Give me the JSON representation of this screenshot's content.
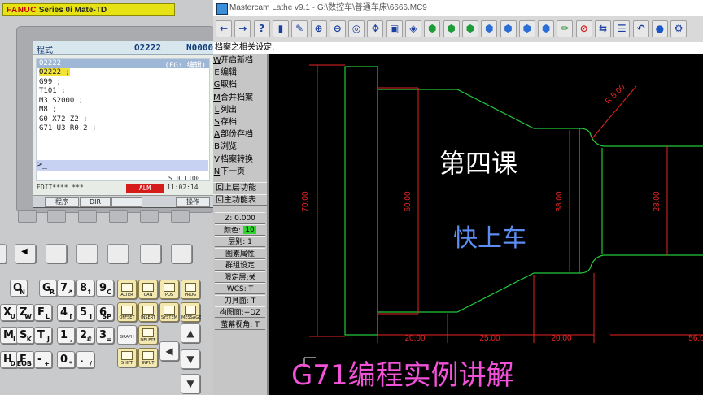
{
  "fanuc": {
    "title_brand": "FANUC",
    "title_rest": " Series 0i Mate-TD",
    "screen": {
      "header_left": "程式",
      "header_prog": "O2222",
      "header_right": "N0000",
      "prog_bar_left": "O2222",
      "prog_bar_right": "(FG: 编辑)",
      "lines": [
        "O2222 ;",
        "G99 ;",
        "T101 ;",
        "M3 S2000 ;",
        "M8 ;",
        "G0 X72 Z2 ;",
        "G71 U3 R0.2 ;"
      ],
      "input_prompt": ">_",
      "status_s": "S   0 L100",
      "mode": "EDIT**** ***",
      "alarm": "ALM",
      "time": "11:02:14",
      "soft_keys": [
        "程序",
        "DIR",
        "",
        "操作"
      ]
    },
    "keys": [
      {
        "big": "O",
        "sm": "N"
      },
      {
        "big": "G",
        "sm": "R"
      },
      {
        "big": "7",
        "sm": "↗"
      },
      {
        "big": "8",
        "sm": "↑"
      },
      {
        "big": "9",
        "sm": "C"
      },
      {
        "big": "X",
        "sm": "U"
      },
      {
        "big": "Z",
        "sm": "W"
      },
      {
        "big": "F",
        "sm": "L"
      },
      {
        "big": "4",
        "sm": "["
      },
      {
        "big": "5",
        "sm": "]"
      },
      {
        "big": "6",
        "sm": "SP"
      },
      {
        "big": "M",
        "sm": "I"
      },
      {
        "big": "S",
        "sm": "K"
      },
      {
        "big": "T",
        "sm": "J"
      },
      {
        "big": "1",
        "sm": ","
      },
      {
        "big": "2",
        "sm": "#"
      },
      {
        "big": "3",
        "sm": "="
      },
      {
        "big": "H",
        "sm": "D"
      },
      {
        "big": "E",
        "sm": "EOB"
      },
      {
        "big": "-",
        "sm": "+"
      },
      {
        "big": "0",
        "sm": "*"
      },
      {
        "big": ".",
        "sm": "/"
      }
    ],
    "function_keys": [
      "ALTER",
      "CAN",
      "POS",
      "PROG",
      "OFFSET",
      "INSERT",
      "SYSTEM",
      "MESSAGE",
      "GRAPH",
      "DELETE",
      "SHIFT",
      "INPUT"
    ]
  },
  "mastercam": {
    "title": "Mastercam Lathe v9.1 - G:\\数控车\\普通车床\\6666.MC9",
    "toolbar_icons": [
      "arrow-left-icon",
      "arrow-right-icon",
      "help-icon",
      "save-icon",
      "measure-icon",
      "zoom-in-icon",
      "zoom-out-icon",
      "zoom-fit-icon",
      "pan-icon",
      "zoom-window-icon",
      "view-iso-icon",
      "cube-top-icon",
      "cube-front-icon",
      "cube-side-icon",
      "cube-iso-icon",
      "cube-back-icon",
      "cube-right-icon",
      "cube-left-icon",
      "pen-icon",
      "clear-icon",
      "swap-icon",
      "layers-icon",
      "undo-icon",
      "shade-icon",
      "gear-icon"
    ],
    "prompt": "档案之相关设定:",
    "menu": [
      {
        "key": "W",
        "label": "开启新档"
      },
      {
        "key": "E",
        "label": "编辑"
      },
      {
        "key": "G",
        "label": "取档"
      },
      {
        "key": "M",
        "label": "合并档案"
      },
      {
        "key": "L",
        "label": "列出"
      },
      {
        "key": "S",
        "label": "存档"
      },
      {
        "key": "A",
        "label": "部份存档"
      },
      {
        "key": "B",
        "label": "浏览"
      },
      {
        "key": "V",
        "label": "档案转换"
      },
      {
        "key": "N",
        "label": "下一页"
      }
    ],
    "nav": [
      "回上层功能",
      "回主功能表"
    ],
    "status": {
      "z": "Z: 0.000",
      "color_label": "颜色:",
      "color_value": "10",
      "layer": "层别: 1",
      "attr": "图素属性",
      "group": "群组设定",
      "limit": "限定层:关",
      "wcs": "WCS: T",
      "tool_plane": "刀具面: T",
      "construct": "构图面:+DZ",
      "view": "萤幕视角: T"
    },
    "dims": {
      "radius": "R 5.00",
      "d70": "70.00",
      "d60": "60.00",
      "d38": "38.00",
      "d28": "28.00",
      "l20a": "20.00",
      "l25": "25.00",
      "l20b": "20.00",
      "l56": "56.0"
    }
  },
  "captions": {
    "title": "第四课",
    "subtitle": "快上车",
    "bottom": "G71编程实例讲解"
  },
  "colors": {
    "part_outline": "#22c83a",
    "dimension": "#e82424",
    "caption_title": "#ffffff",
    "caption_sub": "#5b8df2",
    "caption_bottom": "#f252d8",
    "alarm": "#d61b1b",
    "fanuc_title_bg": "#e6e214"
  }
}
